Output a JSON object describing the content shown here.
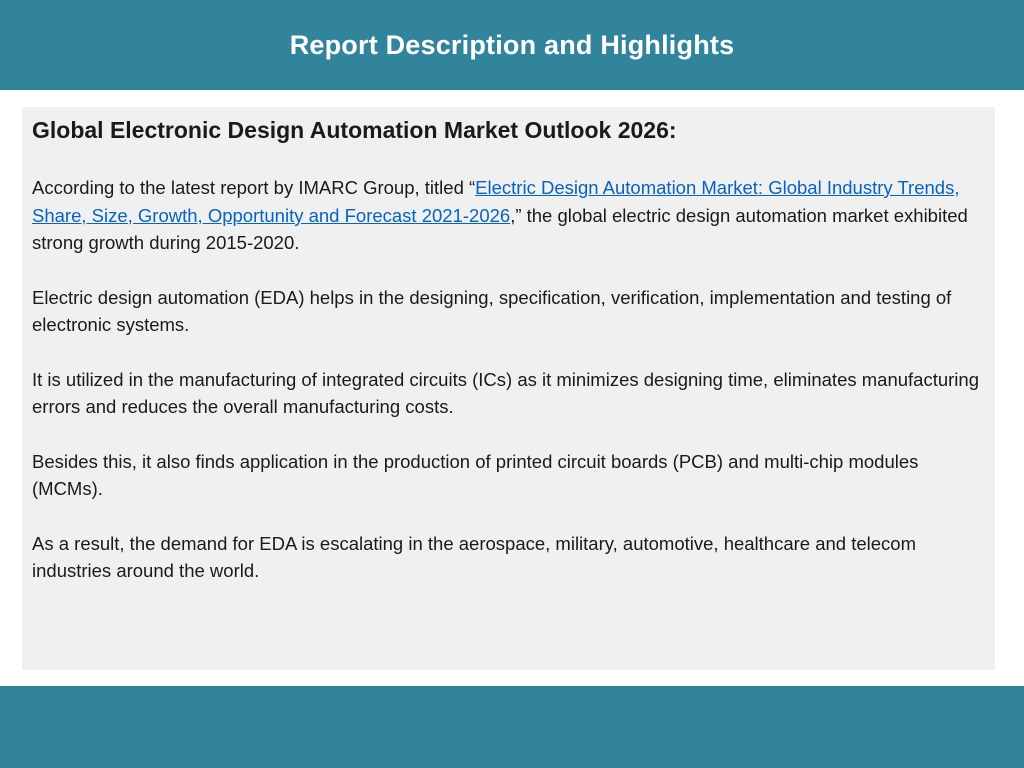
{
  "header": {
    "title": "Report Description and Highlights"
  },
  "content": {
    "heading": "Global Electronic Design Automation Market Outlook 2026:",
    "para1": {
      "before": "According to the latest report by IMARC Group, titled “",
      "link_text": "Electric Design Automation Market: Global Industry Trends, Share, Size, Growth, Opportunity and Forecast 2021-2026",
      "after": ",” the global electric design automation market exhibited strong growth during 2015-2020."
    },
    "para2": "Electric design automation (EDA) helps in the designing, specification, verification, implementation and testing of electronic systems.",
    "para3": "It is utilized in the manufacturing of integrated circuits (ICs) as it minimizes designing time, eliminates manufacturing errors and reduces the overall manufacturing costs.",
    "para4": "Besides this, it also finds application in the production of printed circuit boards (PCB) and multi-chip modules (MCMs).",
    "para5": "As a result, the demand for EDA is escalating in the aerospace, military, automotive, healthcare and telecom industries around the world."
  },
  "colors": {
    "band": "#31849b",
    "panel": "#f0f0f0",
    "link": "#0563c1"
  }
}
